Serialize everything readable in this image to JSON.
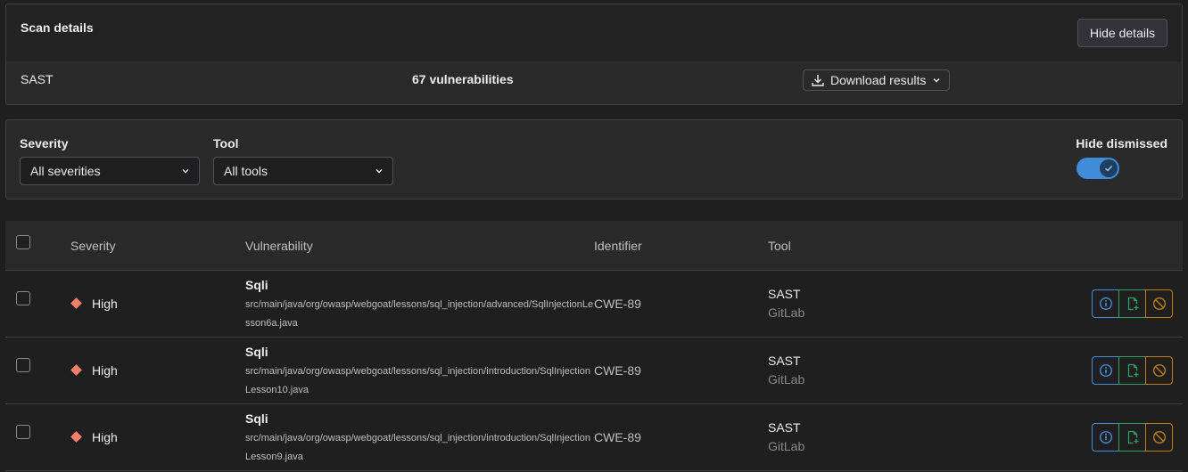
{
  "scan": {
    "title": "Scan details",
    "hide_details_label": "Hide details",
    "type": "SAST",
    "vuln_count": "67 vulnerabilities",
    "download_label": "Download results"
  },
  "filters": {
    "severity_label": "Severity",
    "severity_value": "All severities",
    "tool_label": "Tool",
    "tool_value": "All tools",
    "hide_dismissed_label": "Hide dismissed",
    "hide_dismissed_on": true
  },
  "table": {
    "headers": {
      "severity": "Severity",
      "vulnerability": "Vulnerability",
      "identifier": "Identifier",
      "tool": "Tool"
    },
    "rows": [
      {
        "severity": "High",
        "title": "Sqli",
        "path": "src/main/java/org/owasp/webgoat/lessons/sql_injection/advanced/SqlInjectionLesson6a.java",
        "identifier": "CWE-89",
        "tool": "SAST",
        "vendor": "GitLab"
      },
      {
        "severity": "High",
        "title": "Sqli",
        "path": "src/main/java/org/owasp/webgoat/lessons/sql_injection/introduction/SqlInjectionLesson10.java",
        "identifier": "CWE-89",
        "tool": "SAST",
        "vendor": "GitLab"
      },
      {
        "severity": "High",
        "title": "Sqli",
        "path": "src/main/java/org/owasp/webgoat/lessons/sql_injection/introduction/SqlInjectionLesson9.java",
        "identifier": "CWE-89",
        "tool": "SAST",
        "vendor": "GitLab"
      }
    ]
  },
  "colors": {
    "severity_high": "#f57f6c",
    "toggle_on": "#418cd8",
    "info_action": "#418cd8",
    "issue_action": "#2da160",
    "dismiss_action": "#c17d10"
  }
}
